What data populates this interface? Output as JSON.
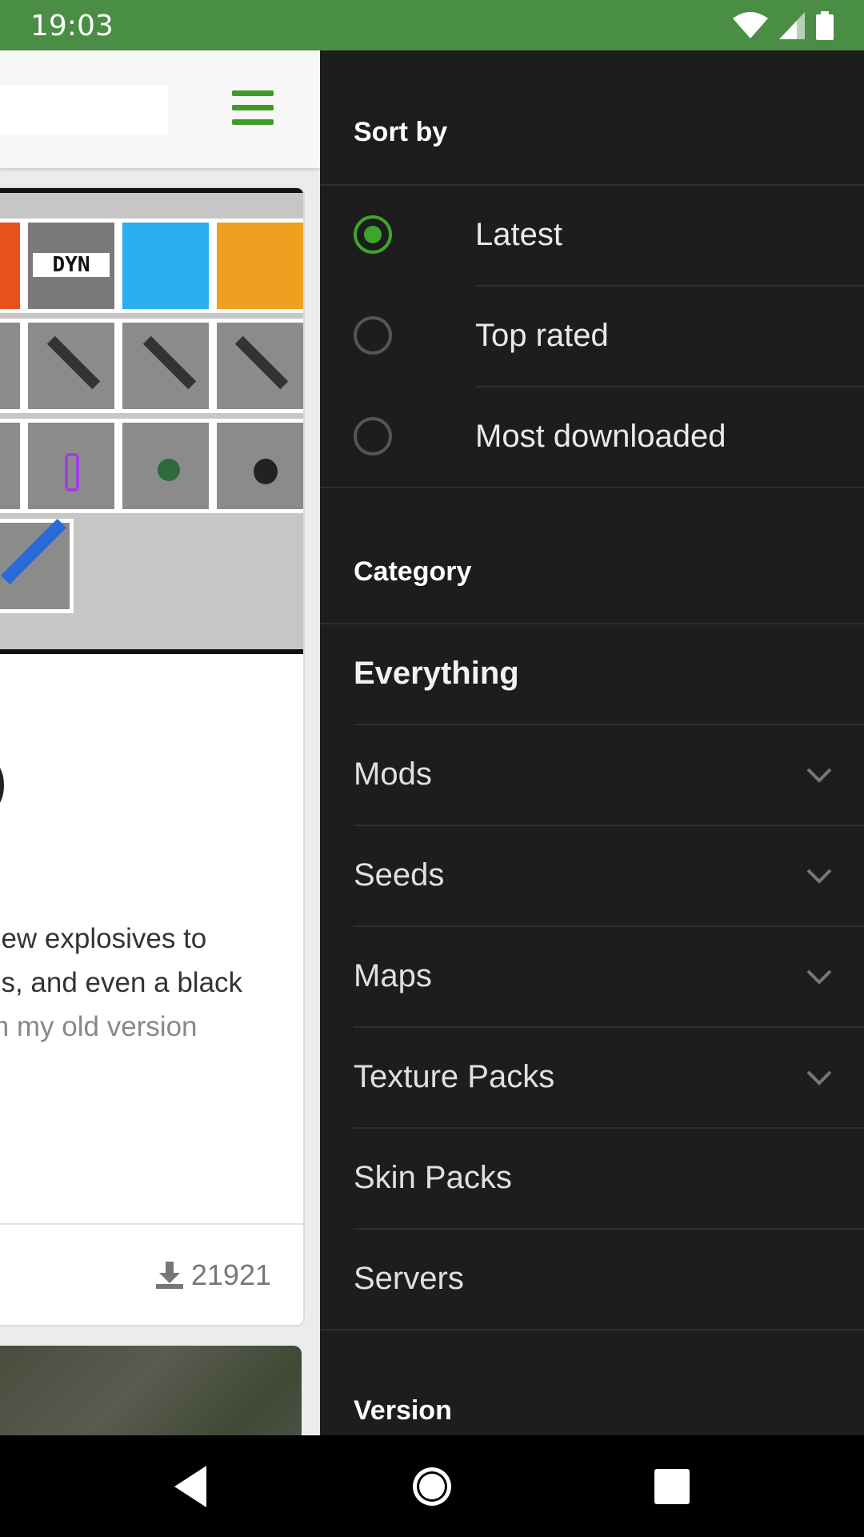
{
  "status_bar": {
    "time": "19:03"
  },
  "app": {
    "card": {
      "title_fragment": ")",
      "description_lines": [
        "new explosives to",
        "es, and even a black",
        "m my old version"
      ],
      "downloads": "21921",
      "image_label": "DYN"
    }
  },
  "drawer": {
    "sort_by": {
      "header": "Sort by",
      "options": [
        {
          "label": "Latest",
          "selected": true
        },
        {
          "label": "Top rated",
          "selected": false
        },
        {
          "label": "Most downloaded",
          "selected": false
        }
      ]
    },
    "category": {
      "header": "Category",
      "items": [
        {
          "label": "Everything",
          "expandable": false
        },
        {
          "label": "Mods",
          "expandable": true
        },
        {
          "label": "Seeds",
          "expandable": true
        },
        {
          "label": "Maps",
          "expandable": true
        },
        {
          "label": "Texture Packs",
          "expandable": true
        },
        {
          "label": "Skin Packs",
          "expandable": false
        },
        {
          "label": "Servers",
          "expandable": false
        }
      ]
    },
    "version": {
      "header": "Version"
    }
  },
  "colors": {
    "status_bar": "#4a8d45",
    "accent": "#3fa52a",
    "drawer_bg": "#1d1d1d"
  },
  "icons": {
    "status": [
      "wifi-icon",
      "signal-icon",
      "battery-icon"
    ],
    "nav": [
      "back-icon",
      "home-icon",
      "recents-icon"
    ]
  }
}
